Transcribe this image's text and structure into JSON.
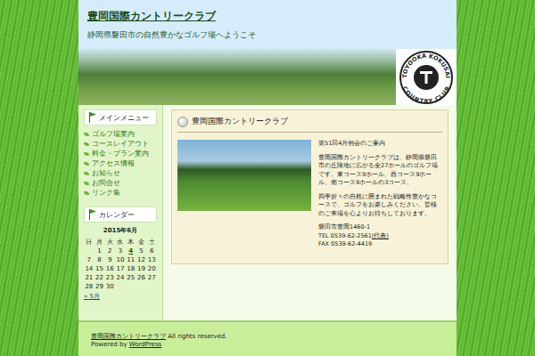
{
  "site": {
    "title": "豊岡国際カントリークラブ",
    "tagline": "静岡県磐田市の自然豊かなゴルフ場へようこそ"
  },
  "logo": {
    "top": "TOYOOKA KOKUSAI",
    "bottom": "COUNTRY CLUB"
  },
  "menu": {
    "heading": "メインメニュー",
    "items": [
      "ゴルフ場案内",
      "コースレイアウト",
      "料金・プラン案内",
      "アクセス情報",
      "お知らせ",
      "お問合せ",
      "リンク集"
    ]
  },
  "calendar": {
    "heading": "カレンダー",
    "month": "2015年6月",
    "weekdays": [
      "日",
      "月",
      "火",
      "水",
      "木",
      "金",
      "土"
    ],
    "weeks": [
      [
        {
          "day": "",
          "linked": false
        },
        {
          "day": "1",
          "linked": false
        },
        {
          "day": "2",
          "linked": false
        },
        {
          "day": "3",
          "linked": false
        },
        {
          "day": "4",
          "linked": true
        },
        {
          "day": "5",
          "linked": false
        },
        {
          "day": "6",
          "linked": false
        }
      ],
      [
        {
          "day": "7",
          "linked": false
        },
        {
          "day": "8",
          "linked": false
        },
        {
          "day": "9",
          "linked": false
        },
        {
          "day": "10",
          "linked": false
        },
        {
          "day": "11",
          "linked": false
        },
        {
          "day": "12",
          "linked": false
        },
        {
          "day": "13",
          "linked": false
        }
      ],
      [
        {
          "day": "14",
          "linked": false
        },
        {
          "day": "15",
          "linked": false
        },
        {
          "day": "16",
          "linked": false
        },
        {
          "day": "17",
          "linked": false
        },
        {
          "day": "18",
          "linked": false
        },
        {
          "day": "19",
          "linked": false
        },
        {
          "day": "20",
          "linked": false
        }
      ],
      [
        {
          "day": "21",
          "linked": false
        },
        {
          "day": "22",
          "linked": false
        },
        {
          "day": "23",
          "linked": false
        },
        {
          "day": "24",
          "linked": false
        },
        {
          "day": "25",
          "linked": false
        },
        {
          "day": "26",
          "linked": false
        },
        {
          "day": "27",
          "linked": false
        }
      ],
      [
        {
          "day": "28",
          "linked": false
        },
        {
          "day": "29",
          "linked": false
        },
        {
          "day": "30",
          "linked": false
        },
        {
          "day": "",
          "linked": false
        },
        {
          "day": "",
          "linked": false
        },
        {
          "day": "",
          "linked": false
        },
        {
          "day": "",
          "linked": false
        }
      ]
    ],
    "prev": "« 5月"
  },
  "post": {
    "title": "豊岡国際カントリークラブ",
    "lead": "第51回4月例会のご案内",
    "paragraphs": [
      "豊岡国際カントリークラブは、静岡県磐田市の丘陵地に広がる全27ホールのゴルフ場です。東コース9ホール、西コース9ホール、南コース9ホールの3コース。",
      "四季折々の自然に囲まれた戦略性豊かなコースで、ゴルフをお楽しみください。皆様のご来場を心よりお待ちしております。"
    ],
    "address": "磐田市豊岡1460-1",
    "tel": "TEL 0539-62-2561",
    "tel_note": "(代表)",
    "fax": "FAX 0539-62-4419"
  },
  "footer": {
    "site": "豊岡国際カントリークラブ",
    "rights": " All rights reserved.",
    "powered": "Powered by ",
    "engine": "WordPress"
  }
}
